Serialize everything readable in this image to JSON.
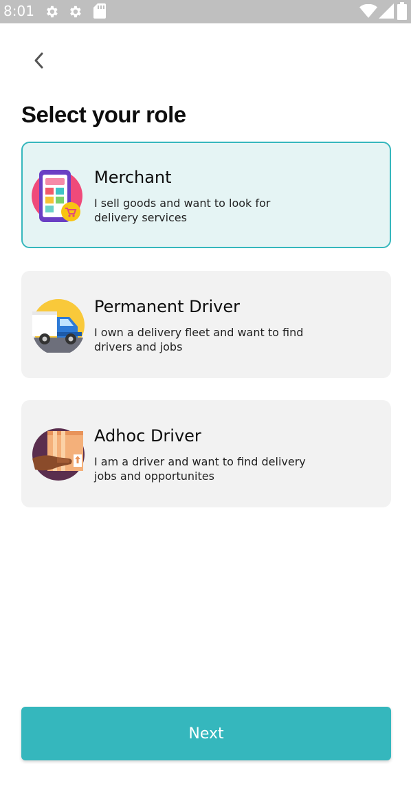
{
  "status_bar": {
    "time": "8:01",
    "left_icons": [
      "settings-gear-icon",
      "settings-gear-icon",
      "sd-card-icon"
    ],
    "right_icons": [
      "wifi-icon",
      "signal-icon",
      "battery-icon"
    ]
  },
  "header": {
    "back_icon": "chevron-left-icon",
    "title": "Select your role"
  },
  "roles": [
    {
      "title": "Merchant",
      "description": "I sell goods and want to look for delivery services",
      "icon": "merchant-phone-shop-icon",
      "selected": true
    },
    {
      "title": "Permanent Driver",
      "description": "I own a delivery fleet and want to find drivers and jobs",
      "icon": "delivery-truck-icon",
      "selected": false
    },
    {
      "title": "Adhoc Driver",
      "description": "I am a driver and want to find delivery jobs and opportunites",
      "icon": "hand-package-icon",
      "selected": false
    }
  ],
  "footer": {
    "next_label": "Next"
  },
  "colors": {
    "accent": "#35b7bd",
    "selected_card_bg": "#e5f4f4",
    "card_bg": "#f2f2f2",
    "status_bar_bg": "#bfbfbf"
  }
}
